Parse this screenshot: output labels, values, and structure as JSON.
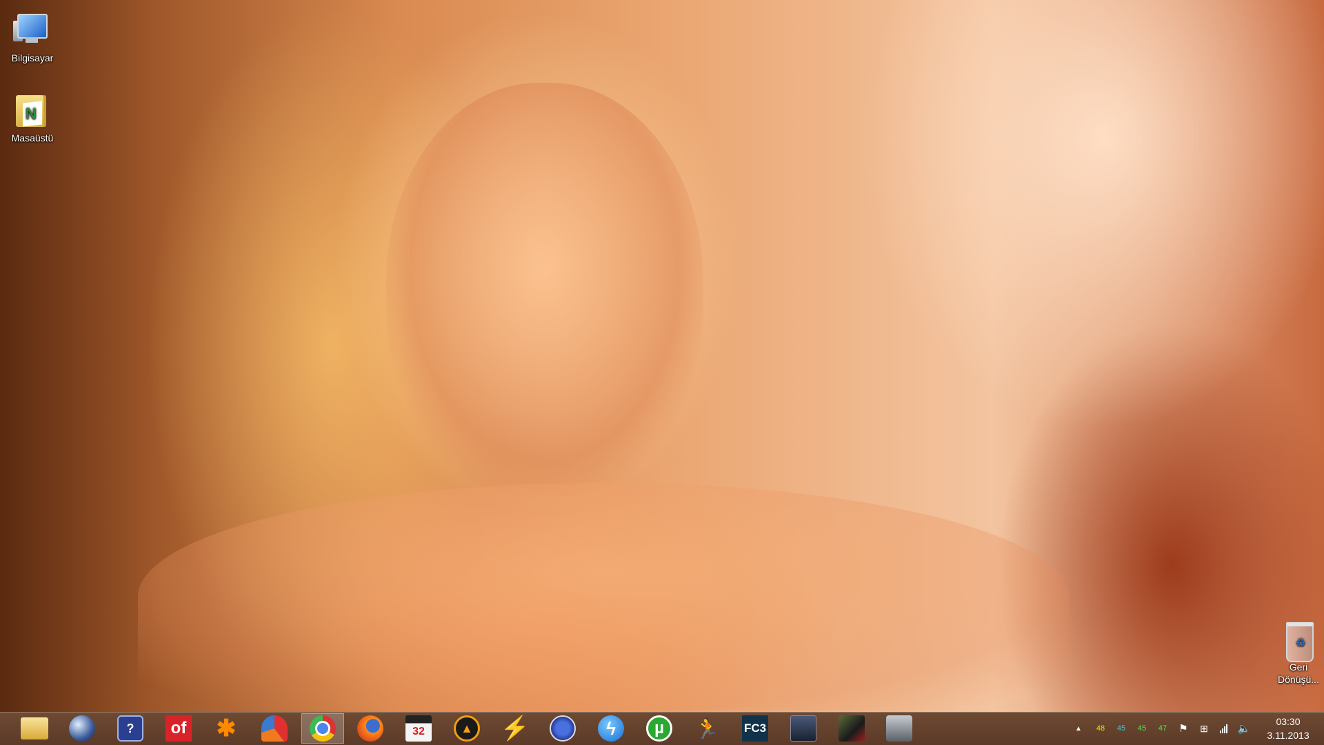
{
  "desktop": {
    "icons": [
      {
        "label": "Bilgisayar"
      },
      {
        "label": "Masaüstü"
      },
      {
        "label": "Geri Dönüşü..."
      }
    ]
  },
  "taskbar": {
    "apps": [
      {
        "name": "file-explorer",
        "icon": "folder-icon"
      },
      {
        "name": "globe-app",
        "icon": "globe-icon"
      },
      {
        "name": "help-app",
        "icon": "help-icon",
        "glyph": "?"
      },
      {
        "name": "office-app",
        "icon": "office-icon",
        "glyph": "of"
      },
      {
        "name": "avast",
        "icon": "avast-icon",
        "glyph": "✱"
      },
      {
        "name": "ccleaner",
        "icon": "ccleaner-icon"
      },
      {
        "name": "chrome",
        "icon": "chrome-icon",
        "active": true
      },
      {
        "name": "firefox",
        "icon": "firefox-icon"
      },
      {
        "name": "video-editor",
        "icon": "clapper-icon",
        "glyph": "32"
      },
      {
        "name": "aimp",
        "icon": "aimp-icon",
        "glyph": "▲"
      },
      {
        "name": "winamp",
        "icon": "winamp-icon",
        "glyph": "⚡"
      },
      {
        "name": "safari-like",
        "icon": "compass-icon"
      },
      {
        "name": "flashget",
        "icon": "bolt-icon",
        "glyph": "ϟ"
      },
      {
        "name": "utorrent",
        "icon": "utorrent-icon",
        "glyph": "µ"
      },
      {
        "name": "counter-strike",
        "icon": "soldier-icon",
        "glyph": "🏃"
      },
      {
        "name": "far-cry-3",
        "icon": "fc3-icon",
        "glyph": "FC3"
      },
      {
        "name": "game-soldier",
        "icon": "helmet-icon"
      },
      {
        "name": "crysis",
        "icon": "crysis-icon"
      },
      {
        "name": "truck-sim",
        "icon": "truck-icon"
      }
    ],
    "tray": {
      "temps": [
        "48",
        "45",
        "45",
        "47"
      ],
      "time": "03:30",
      "date": "3.11.2013"
    }
  },
  "colors": {
    "taskbar": "#5b3a27",
    "temp_yellow": "#e6e600",
    "temp_cyan": "#33ccdd",
    "temp_green": "#44ee44"
  }
}
